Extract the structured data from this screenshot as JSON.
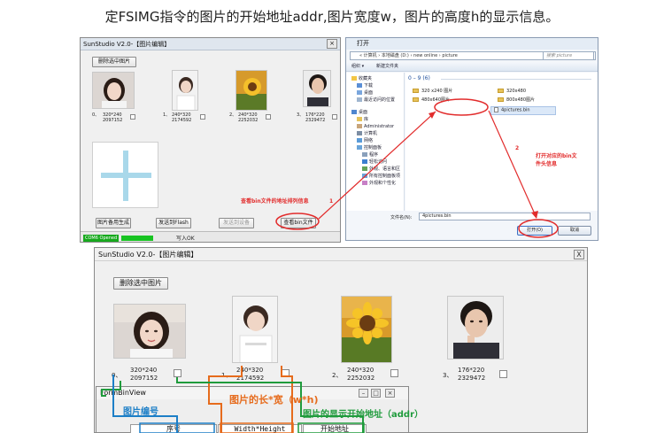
{
  "title": "定FSIMG指令的图片的开始地址addr,图片宽度w，图片的高度h的显示信息。",
  "colors": {
    "annotation_red": "#e22c2c",
    "annotation_orange": "#e66b1c",
    "annotation_green": "#1f9b3c",
    "annotation_blue": "#1d7fc7",
    "status_green": "#17a91d"
  },
  "small_window": {
    "title": "SunStudio V2.0-【图片编辑】",
    "delete_button": "删除选中图片",
    "images": [
      {
        "index": "0、",
        "size": "320*240",
        "addr": "2097152"
      },
      {
        "index": "1、",
        "size": "240*320",
        "addr": "2174592"
      },
      {
        "index": "2、",
        "size": "240*320",
        "addr": "2252032"
      },
      {
        "index": "3、",
        "size": "176*220",
        "addr": "2329472"
      }
    ],
    "buttons": [
      "图片备用生成",
      "发送到Flash",
      "发送到设备",
      "查看bin文件"
    ],
    "status_green": "COM6 Opened",
    "status_ok": "写入OK",
    "annotation": "查看bin文件的地址排列信息",
    "step": "1"
  },
  "open_dialog": {
    "title": "打开",
    "path": "« 计算机 › 本地磁盘 (D:) › new online › picture",
    "search": "搜索 picture",
    "toolbar": [
      "组织 ▾",
      "新建文件夹"
    ],
    "nav": [
      "收藏夹",
      "下载",
      "桌面",
      "最近访问的位置",
      "桌面",
      "库",
      "Administrator",
      "计算机",
      "网络",
      "控制面板",
      "程序",
      "轻松访问",
      "外观、语言和区",
      "所有控制面板项",
      "外观和个性化"
    ],
    "group": "0 – 9 (6)",
    "files": [
      "320 x240 图片",
      "480x640图片",
      "320x480",
      "800x480图片",
      "4pictures.bin"
    ],
    "filename_label": "文件名(N):",
    "filename": "4pictures.bin",
    "open_button": "打开(O)",
    "cancel_button": "取消",
    "annotation": "打开对应的bin文件头信息",
    "step": "2"
  },
  "big_window": {
    "title": "SunStudio V2.0-【图片编辑】",
    "close": "X",
    "delete_button": "删除选中图片",
    "images": [
      {
        "index": "0、",
        "size": "320*240",
        "addr": "2097152"
      },
      {
        "index": "1、",
        "size": "240*320",
        "addr": "2174592"
      },
      {
        "index": "2、",
        "size": "240*320",
        "addr": "2252032"
      },
      {
        "index": "3、",
        "size": "176*220",
        "addr": "2329472"
      }
    ]
  },
  "bin_view": {
    "title": "FormBinView",
    "columns": [
      "序号",
      "Width*Height",
      "开始地址"
    ]
  },
  "annotations": {
    "orange": "图片的长*宽（w*h)",
    "blue": "图片编号",
    "green": "图片的显示开始地址（addr）"
  }
}
